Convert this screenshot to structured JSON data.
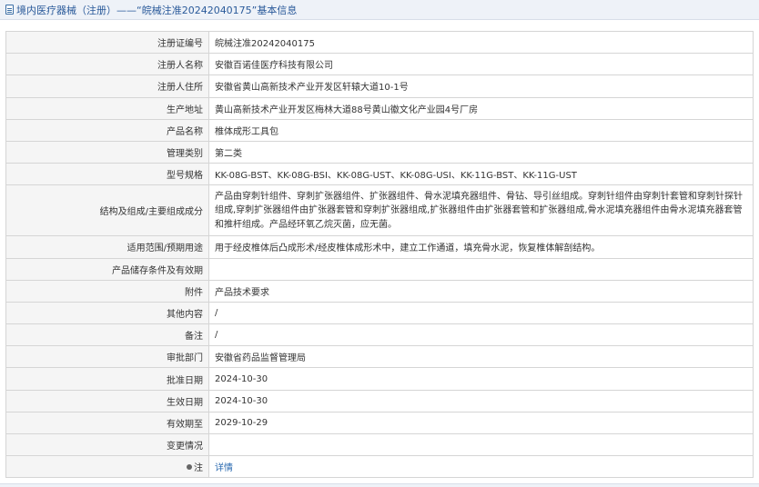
{
  "header": {
    "title": "境内医疗器械（注册）——“皖械注准20242040175”基本信息"
  },
  "rows": [
    {
      "label": "注册证编号",
      "value": "皖械注准20242040175"
    },
    {
      "label": "注册人名称",
      "value": "安徽百诺佳医疗科技有限公司"
    },
    {
      "label": "注册人住所",
      "value": "安徽省黄山高新技术产业开发区轩辕大道10-1号"
    },
    {
      "label": "生产地址",
      "value": "黄山高新技术产业开发区梅林大道88号黄山徽文化产业园4号厂房"
    },
    {
      "label": "产品名称",
      "value": "椎体成形工具包"
    },
    {
      "label": "管理类别",
      "value": "第二类"
    },
    {
      "label": "型号规格",
      "value": "KK-08G-BST、KK-08G-BSI、KK-08G-UST、KK-08G-USI、KK-11G-BST、KK-11G-UST"
    },
    {
      "label": "结构及组成/主要组成成分",
      "value": "产品由穿刺针组件、穿刺扩张器组件、扩张器组件、骨水泥填充器组件、骨钻、导引丝组成。穿刺针组件由穿刺针套管和穿刺针探针组成,穿刺扩张器组件由扩张器套管和穿刺扩张器组成,扩张器组件由扩张器套管和扩张器组成,骨水泥填充器组件由骨水泥填充器套管和推杆组成。产品经环氧乙烷灭菌，应无菌。"
    },
    {
      "label": "适用范围/预期用途",
      "value": "用于经皮椎体后凸成形术/经皮椎体成形术中，建立工作通道，填充骨水泥，恢复椎体解剖结构。"
    },
    {
      "label": "产品储存条件及有效期",
      "value": ""
    },
    {
      "label": "附件",
      "value": "产品技术要求"
    },
    {
      "label": "其他内容",
      "value": "/"
    },
    {
      "label": "备注",
      "value": "/"
    },
    {
      "label": "审批部门",
      "value": "安徽省药品监督管理局"
    },
    {
      "label": "批准日期",
      "value": "2024-10-30"
    },
    {
      "label": "生效日期",
      "value": "2024-10-30"
    },
    {
      "label": "有效期至",
      "value": "2029-10-29"
    },
    {
      "label": "变更情况",
      "value": ""
    },
    {
      "label": "注",
      "value": "详情"
    }
  ]
}
